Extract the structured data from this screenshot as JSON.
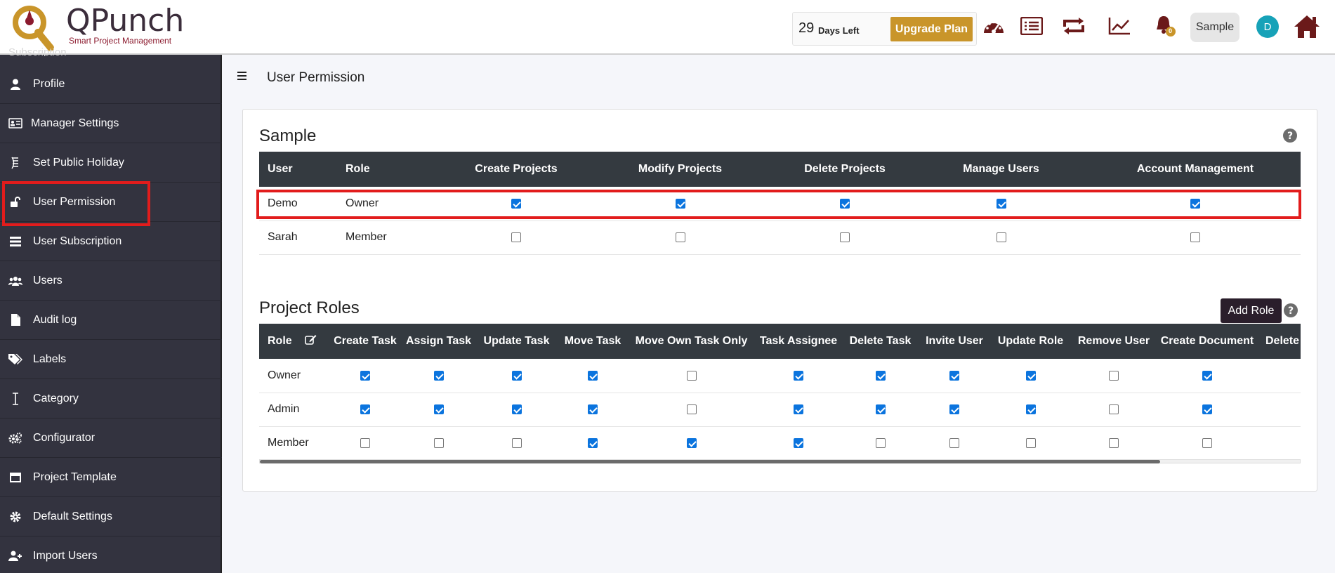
{
  "header": {
    "logo_text": "QPunch",
    "logo_subtitle": "Smart Project Management",
    "days_number": "29",
    "days_label": "Days Left",
    "upgrade_label": "Upgrade Plan",
    "notification_count": "0",
    "workspace_label": "Sample",
    "avatar_initial": "D"
  },
  "sidebar": {
    "cut_item": "Subscription",
    "items": [
      {
        "label": "Profile",
        "icon": "user-icon"
      },
      {
        "label": "Manager Settings",
        "icon": "id-card-icon"
      },
      {
        "label": "Set Public Holiday",
        "icon": "holiday-icon"
      },
      {
        "label": "User Permission",
        "icon": "unlock-icon"
      },
      {
        "label": "User Subscription",
        "icon": "list-icon"
      },
      {
        "label": "Users",
        "icon": "users-icon"
      },
      {
        "label": "Audit log",
        "icon": "file-icon"
      },
      {
        "label": "Labels",
        "icon": "tags-icon"
      },
      {
        "label": "Category",
        "icon": "text-cursor-icon"
      },
      {
        "label": "Configurator",
        "icon": "cogs-icon"
      },
      {
        "label": "Project Template",
        "icon": "window-icon"
      },
      {
        "label": "Default Settings",
        "icon": "gear-icon"
      },
      {
        "label": "Import Users",
        "icon": "user-plus-icon"
      }
    ]
  },
  "page": {
    "title": "User Permission"
  },
  "workspace_section": {
    "title": "Sample",
    "columns": [
      "User",
      "Role",
      "Create Projects",
      "Modify Projects",
      "Delete Projects",
      "Manage Users",
      "Account Management"
    ],
    "rows": [
      {
        "user": "Demo",
        "role": "Owner",
        "perms": [
          true,
          true,
          true,
          true,
          true
        ]
      },
      {
        "user": "Sarah",
        "role": "Member",
        "perms": [
          false,
          false,
          false,
          false,
          false
        ]
      }
    ]
  },
  "roles_section": {
    "title": "Project Roles",
    "add_label": "Add Role",
    "columns": [
      "Role",
      "Create Task",
      "Assign Task",
      "Update Task",
      "Move Task",
      "Move Own Task Only",
      "Task Assignee",
      "Delete Task",
      "Invite User",
      "Update Role",
      "Remove User",
      "Create Document",
      "Delete"
    ],
    "rows": [
      {
        "role": "Owner",
        "perms": [
          true,
          true,
          true,
          true,
          false,
          true,
          true,
          true,
          true,
          false,
          true
        ]
      },
      {
        "role": "Admin",
        "perms": [
          true,
          true,
          true,
          true,
          false,
          true,
          true,
          true,
          true,
          false,
          true
        ]
      },
      {
        "role": "Member",
        "perms": [
          false,
          false,
          false,
          true,
          true,
          true,
          false,
          false,
          false,
          false,
          false
        ]
      }
    ]
  },
  "colors": {
    "sidebar_bg": "#33333f",
    "table_header_bg": "#343a40",
    "upgrade_bg": "#c9952a",
    "highlight": "#e21c1c",
    "checkbox_on": "#0b74de",
    "icon_dark_red": "#6b1a1a"
  }
}
